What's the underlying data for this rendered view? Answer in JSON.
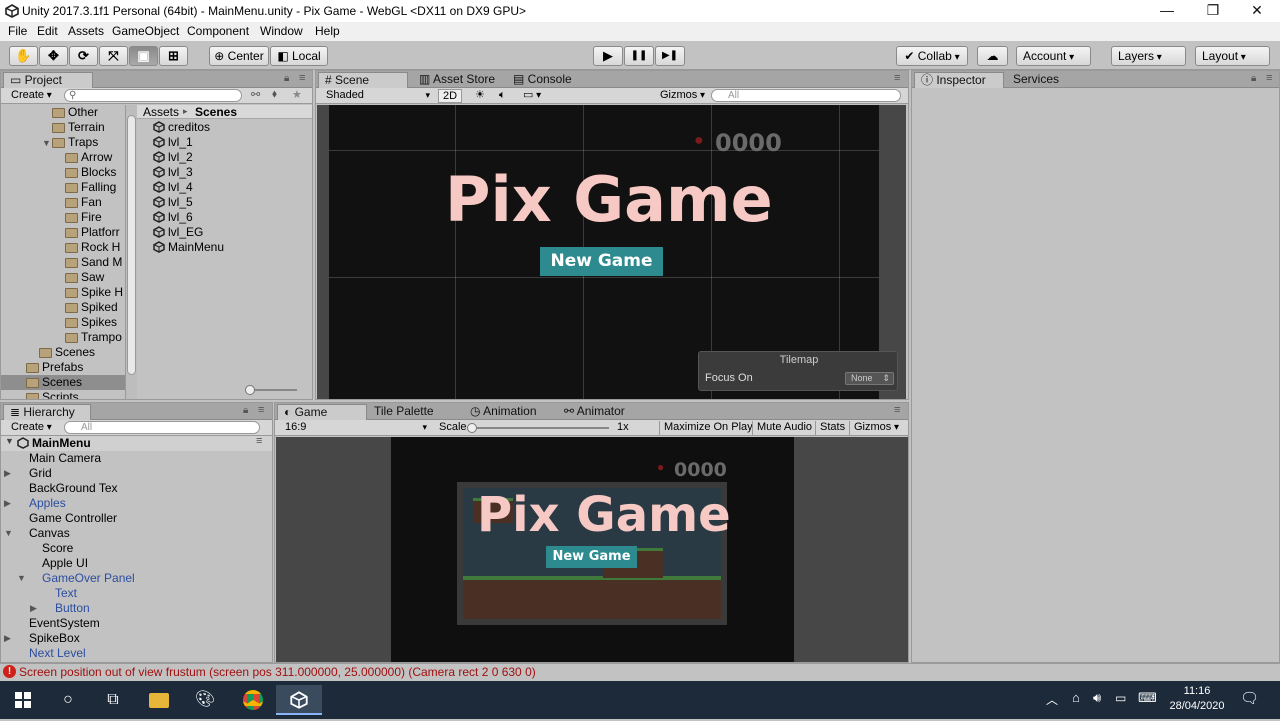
{
  "window": {
    "title": "Unity 2017.3.1f1 Personal (64bit) - MainMenu.unity - Pix Game - WebGL <DX11 on DX9 GPU>",
    "minimize": "—",
    "maximize": "❐",
    "close": "✕"
  },
  "menu": [
    "File",
    "Edit",
    "Assets",
    "GameObject",
    "Component",
    "Window",
    "Help"
  ],
  "toolbar": {
    "tools": [
      "✋",
      "✥",
      "⟳",
      "⤧",
      "▣",
      "⊞"
    ],
    "pivot": "Center",
    "space": "Local",
    "play": "▶",
    "pause": "❚❚",
    "step": "▶❚",
    "collab": "Collab",
    "cloud": "☁",
    "account": "Account",
    "layers": "Layers",
    "layout": "Layout"
  },
  "project": {
    "tab": "Project",
    "create": "Create",
    "breadcrumb_root": "Assets",
    "breadcrumb_sep": "▸",
    "breadcrumb_current": "Scenes",
    "tree": [
      {
        "label": "Other",
        "indent": 3
      },
      {
        "label": "Terrain",
        "indent": 3
      },
      {
        "label": "Traps",
        "indent": 3,
        "expanded": true
      },
      {
        "label": "Arrow",
        "indent": 4
      },
      {
        "label": "Blocks",
        "indent": 4
      },
      {
        "label": "Falling",
        "indent": 4
      },
      {
        "label": "Fan",
        "indent": 4
      },
      {
        "label": "Fire",
        "indent": 4
      },
      {
        "label": "Platforr",
        "indent": 4
      },
      {
        "label": "Rock H",
        "indent": 4
      },
      {
        "label": "Sand M",
        "indent": 4
      },
      {
        "label": "Saw",
        "indent": 4
      },
      {
        "label": "Spike H",
        "indent": 4
      },
      {
        "label": "Spiked",
        "indent": 4
      },
      {
        "label": "Spikes",
        "indent": 4
      },
      {
        "label": "Trampo",
        "indent": 4
      },
      {
        "label": "Scenes",
        "indent": 2
      },
      {
        "label": "Prefabs",
        "indent": 1
      },
      {
        "label": "Scenes",
        "indent": 1,
        "selected": true
      },
      {
        "label": "Scripts",
        "indent": 1
      }
    ],
    "files": [
      "creditos",
      "lvl_1",
      "lvl_2",
      "lvl_3",
      "lvl_4",
      "lvl_5",
      "lvl_6",
      "lvl_EG",
      "MainMenu"
    ]
  },
  "scene": {
    "tabs": [
      "Scene",
      "Asset Store",
      "Console"
    ],
    "shading": "Shaded",
    "mode2d": "2D",
    "gizmos": "Gizmos",
    "search_placeholder": "All",
    "game_title": "Pix Game",
    "button": "New Game",
    "counter": "0000",
    "tilemap_title": "Tilemap",
    "focus_label": "Focus On",
    "focus_value": "None"
  },
  "inspector": {
    "tabs": [
      "Inspector",
      "Services"
    ]
  },
  "hierarchy": {
    "tab": "Hierarchy",
    "create": "Create",
    "search_placeholder": "All",
    "scene_name": "MainMenu",
    "items": [
      {
        "label": "Main Camera",
        "indent": 1,
        "arrow": ""
      },
      {
        "label": "Grid",
        "indent": 1,
        "arrow": "▶"
      },
      {
        "label": "BackGround Tex",
        "indent": 1,
        "arrow": ""
      },
      {
        "label": "Apples",
        "indent": 1,
        "arrow": "▶",
        "color": "#2c4ea0"
      },
      {
        "label": "Game Controller",
        "indent": 1,
        "arrow": ""
      },
      {
        "label": "Canvas",
        "indent": 1,
        "arrow": "▼"
      },
      {
        "label": "Score",
        "indent": 2,
        "arrow": ""
      },
      {
        "label": "Apple UI",
        "indent": 2,
        "arrow": ""
      },
      {
        "label": "GameOver Panel",
        "indent": 2,
        "arrow": "▼",
        "color": "#2c4ea0"
      },
      {
        "label": "Text",
        "indent": 3,
        "arrow": "",
        "color": "#2c4ea0"
      },
      {
        "label": "Button",
        "indent": 3,
        "arrow": "▶",
        "color": "#2c4ea0"
      },
      {
        "label": "EventSystem",
        "indent": 1,
        "arrow": ""
      },
      {
        "label": "SpikeBox",
        "indent": 1,
        "arrow": "▶"
      },
      {
        "label": "Next Level",
        "indent": 1,
        "arrow": "",
        "color": "#2c4ea0"
      }
    ]
  },
  "game": {
    "tabs": [
      "Game",
      "Tile Palette",
      "Animation",
      "Animator"
    ],
    "aspect": "16:9",
    "scale_label": "Scale",
    "scale_value": "1x",
    "maximize": "Maximize On Play",
    "mute": "Mute Audio",
    "stats": "Stats",
    "gizmos": "Gizmos",
    "game_title": "Pix Game",
    "button": "New Game",
    "counter": "0000"
  },
  "status": {
    "message": "Screen position out of view frustum (screen pos 311.000000, 25.000000) (Camera rect 2 0 630 0)"
  },
  "taskbar": {
    "time": "11:16",
    "date": "28/04/2020"
  }
}
